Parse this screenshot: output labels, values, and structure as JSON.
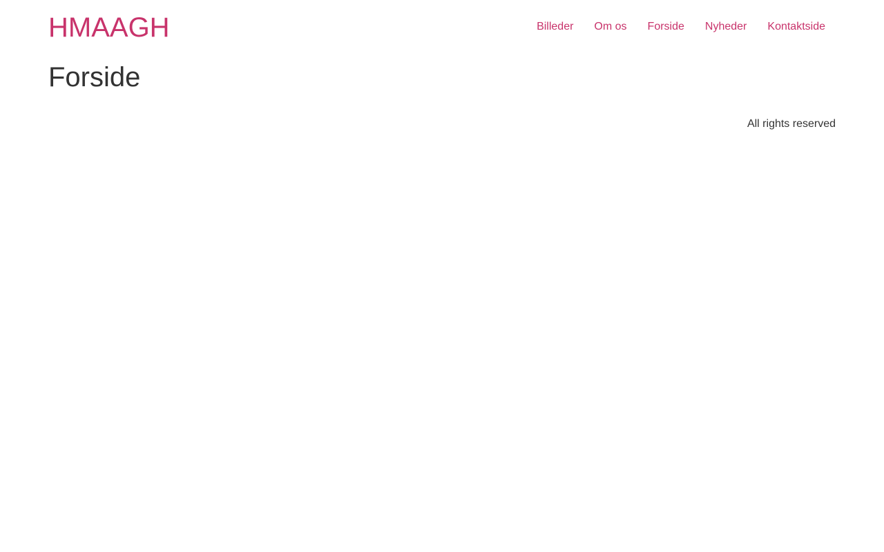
{
  "header": {
    "site_title": "HMAAGH",
    "nav": [
      {
        "label": "Billeder"
      },
      {
        "label": "Om os"
      },
      {
        "label": "Forside"
      },
      {
        "label": "Nyheder"
      },
      {
        "label": "Kontaktside"
      }
    ]
  },
  "main": {
    "page_title": "Forside"
  },
  "footer": {
    "copyright": "All rights reserved"
  },
  "colors": {
    "accent": "#c8336b",
    "text": "#333333",
    "background": "#ffffff"
  }
}
